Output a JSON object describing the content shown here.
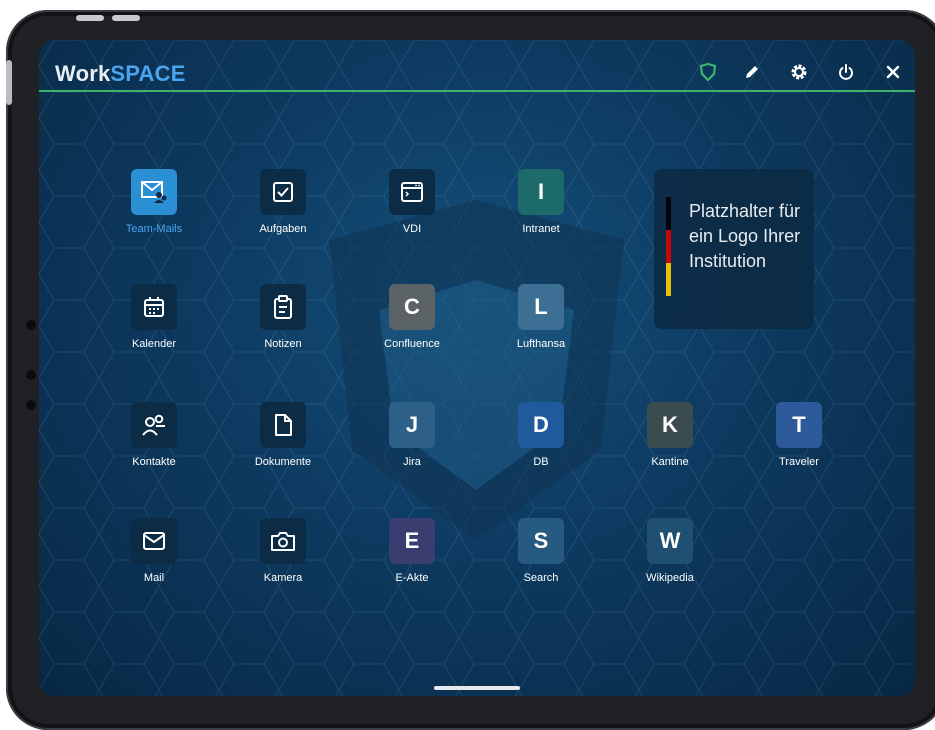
{
  "header": {
    "logo_part1": "Work",
    "logo_part2": "SPACE",
    "icons": [
      "shield-icon",
      "pencil-icon",
      "gear-icon",
      "power-icon",
      "close-icon"
    ]
  },
  "colors": {
    "accent_green": "#3fb36b",
    "accent_blue": "#4ba4f0",
    "active_tile": "#2b8fd4",
    "tile_default": "#0c2b44"
  },
  "apps": [
    {
      "label": "Team-Mails",
      "icon": "team-mail-icon",
      "active": true
    },
    {
      "label": "Aufgaben",
      "icon": "checkbox-icon"
    },
    {
      "label": "VDI",
      "icon": "window-icon"
    },
    {
      "label": "Intranet",
      "letter": "I",
      "color": "#1c6b6a"
    },
    {
      "label": "Kalender",
      "icon": "calendar-icon"
    },
    {
      "label": "Notizen",
      "icon": "clipboard-icon"
    },
    {
      "label": "Confluence",
      "letter": "C",
      "color": "#5c6367"
    },
    {
      "label": "Lufthansa",
      "letter": "L",
      "color": "#3d6e94"
    },
    {
      "label": "Kontakte",
      "icon": "contacts-icon"
    },
    {
      "label": "Dokumente",
      "icon": "document-icon"
    },
    {
      "label": "Jira",
      "letter": "J",
      "color": "#2e5f86"
    },
    {
      "label": "DB",
      "letter": "D",
      "color": "#1e5a9c"
    },
    {
      "label": "Kantine",
      "letter": "K",
      "color": "#3a4c50"
    },
    {
      "label": "Traveler",
      "letter": "T",
      "color": "#2d5a9a"
    },
    {
      "label": "Mail",
      "icon": "mail-icon"
    },
    {
      "label": "Kamera",
      "icon": "camera-icon"
    },
    {
      "label": "E-Akte",
      "letter": "E",
      "color": "#3a3d70"
    },
    {
      "label": "Search",
      "letter": "S",
      "color": "#265a80"
    },
    {
      "label": "Wikipedia",
      "letter": "W",
      "color": "#1f4f72"
    }
  ],
  "placeholder": {
    "text_line1": "Platzhalter für",
    "text_line2": "ein Logo Ihrer",
    "text_line3": "Institution",
    "flag_colors": [
      "#000000",
      "#dd0000",
      "#ffce00"
    ]
  }
}
